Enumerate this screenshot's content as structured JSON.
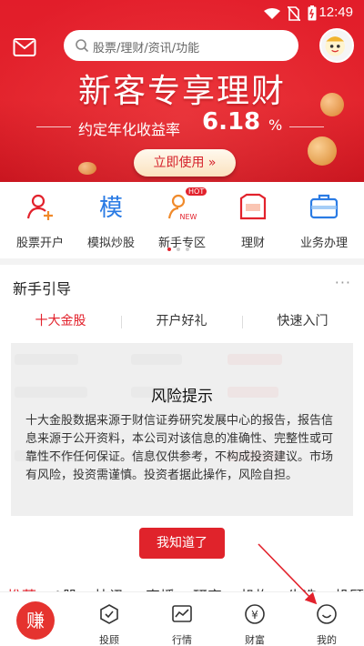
{
  "status_bar": {
    "time": "12:49"
  },
  "search": {
    "placeholder": "股票/理财/资讯/功能"
  },
  "banner": {
    "headline": "新客专享理财",
    "subline": "约定年化收益率",
    "rate": "6.18",
    "rate_unit": "%",
    "cta": "立即使用 »"
  },
  "quick_actions": [
    {
      "label": "股票开户",
      "icon": "person-add-icon"
    },
    {
      "label": "模拟炒股",
      "icon": "mock-trade-icon"
    },
    {
      "label": "新手专区",
      "icon": "newbie-icon",
      "badge_top": "HOT",
      "badge_bottom": "NEW"
    },
    {
      "label": "理财",
      "icon": "wallet-icon"
    },
    {
      "label": "业务办理",
      "icon": "briefcase-icon"
    }
  ],
  "guide": {
    "title": "新手引导",
    "more": "···",
    "tabs": [
      "十大金股",
      "开户好礼",
      "快速入门"
    ],
    "active_tab": 0
  },
  "risk_dialog": {
    "title": "风险提示",
    "body": "十大金股数据来源于财信证券研究发展中心的报告，报告信息来源于公开资料，本公司对该信息的准确性、完整性或可靠性不作任何保证。信息仅供参考，不构成投资建议。市场有风险，投资需谨慎。投资者据此操作，风险自担。",
    "ok_button": "我知道了"
  },
  "news_tabs_partial": [
    "推荐",
    "A股",
    "快讯",
    "直播",
    "研究",
    "机构",
    "牛选",
    "投顾"
  ],
  "bottom_nav": {
    "earn": "赚",
    "items": [
      {
        "label": "投顾",
        "icon": "advisor-icon"
      },
      {
        "label": "行情",
        "icon": "market-chart-icon"
      },
      {
        "label": "财富",
        "icon": "wealth-yen-icon"
      },
      {
        "label": "我的",
        "icon": "profile-smile-icon"
      }
    ]
  },
  "colors": {
    "brand_red": "#e2222c",
    "accent_gold": "#fbe2be"
  }
}
